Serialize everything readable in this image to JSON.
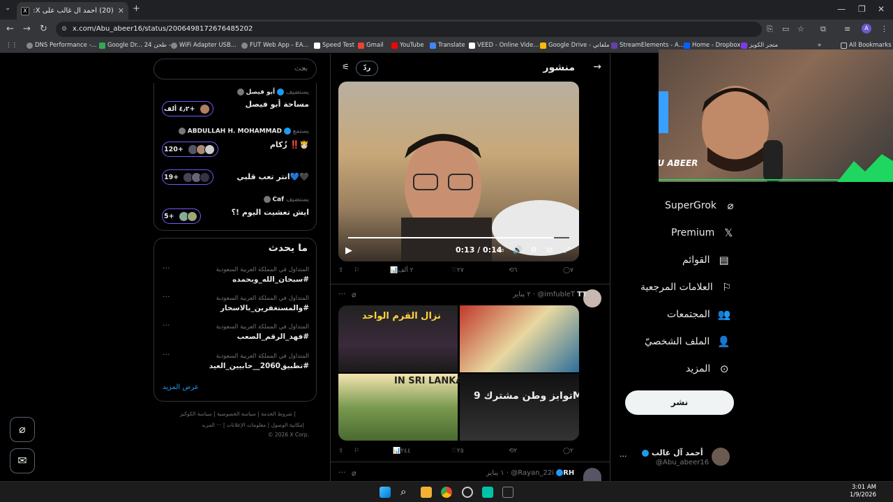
{
  "browser": {
    "tab_title": "(20) أحمد آل غالب على X: \"الى ...",
    "tab_favicon": "X",
    "url": "x.com/Abu_abeer16/status/2006498172676485202",
    "bookmarks": [
      "DNS Performance -...",
      "Google Dr... طحن 24 -",
      "WiFi Adapter USB...",
      "FUT Web App - EA...",
      "Speed Test",
      "Gmail",
      "YouTube",
      "Translate",
      "VEED - Online Vide...",
      "Google Drive - ملفاتي",
      "StreamElements - A...",
      "Home - Dropbox",
      "متجر الكويز"
    ],
    "all_bookmarks": "All Bookmarks",
    "profile_initial": "A"
  },
  "search": {
    "placeholder": "بحث"
  },
  "spaces": [
    {
      "role": "يستضيف",
      "host": "أبو فيصل",
      "title": "مساحة أبو فيصل",
      "count": "٤٫٢ ألف+"
    },
    {
      "role": "يستمع",
      "host": "ABDULLAH H. MOHAMMAD",
      "title": "🫅🏻‼️ زُكام",
      "count": "120+"
    },
    {
      "role": "",
      "host": "",
      "title": "🖤💙انتر تعب قلبي",
      "count": "19+"
    },
    {
      "role": "يستضيف",
      "host": "Caf",
      "title": "ايش تعشيت اليوم !؟",
      "count": "5+"
    }
  ],
  "trends": {
    "heading": "ما يحدث",
    "items": [
      {
        "context": "المتداول في المملكة العربية السعودية",
        "tag": "#سبحان_الله_وبحمده"
      },
      {
        "context": "المتداول في المملكة العربية السعودية",
        "tag": "#والمستغفرين_بالاسحار"
      },
      {
        "context": "المتداول في المملكة العربية السعودية",
        "tag": "#فهد_الرقم_الصعب"
      },
      {
        "context": "المتداول في المملكة العربية السعودية",
        "tag": "#تطبيق2060__حابيين_العيد"
      }
    ],
    "show_more": "عرض المزيد"
  },
  "footer": {
    "line1": "شروط الخدمة | سياسة الخصوصية | سياسة الكوكيز |",
    "line2": "إمكانية الوصول | معلومات الإعلانات | ··· المزيد",
    "line3": "© 2026 X Corp."
  },
  "post_header": {
    "title": "منشور",
    "reply": "ردّ"
  },
  "video": {
    "time": "0:13 / 0:14",
    "progress": 0.93
  },
  "post_actions": {
    "replies": "٧",
    "reposts": "٦",
    "likes": "٢٧",
    "views": "٢ ألف"
  },
  "tweet2": {
    "name": "TT",
    "handle": "@imfubleT",
    "date": "٢ يناير",
    "replies": "٢",
    "reposts": "٢",
    "likes": "٢٥",
    "views": "٢٤٤"
  },
  "tweet2_images": {
    "img1": "نزال القرم الواحد",
    "img3": "IN SRI LANKA",
    "img4": "توايز وطن مشترك 9M"
  },
  "tweet3": {
    "name": "RH",
    "handle": "@Rayan_22i",
    "date": "١ يناير"
  },
  "webcam": {
    "brand": "ABU ABEER"
  },
  "nav": [
    {
      "icon": "grok-icon",
      "label": "SuperGrok"
    },
    {
      "icon": "x-icon",
      "label": "Premium"
    },
    {
      "icon": "list-icon",
      "label": "القوائم"
    },
    {
      "icon": "bookmark-icon",
      "label": "العلامات المرجعية"
    },
    {
      "icon": "communities-icon",
      "label": "المجتمعات"
    },
    {
      "icon": "profile-icon",
      "label": "الملف الشخصيّ"
    },
    {
      "icon": "more-circle-icon",
      "label": "المزيد"
    }
  ],
  "post_button": "نشر",
  "profile": {
    "name": "أحمد آل غالب",
    "handle": "@Abu_abeer16"
  },
  "taskbar": {
    "time": "3:01 AM",
    "date": "1/9/2026"
  },
  "colors": {
    "accent": "#1d9bf0",
    "space_ring": "#7856ff",
    "bg": "#000000"
  }
}
